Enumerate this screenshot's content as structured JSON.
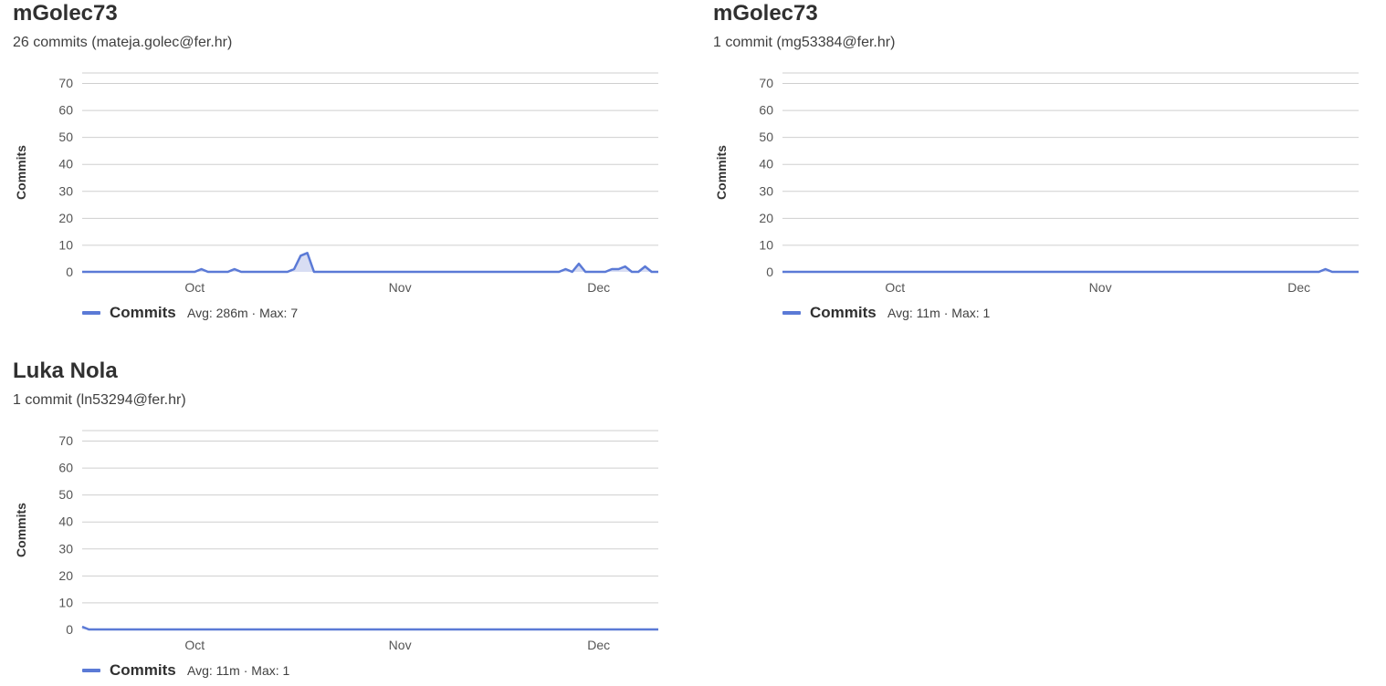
{
  "theme": {
    "line_color": "#5b7ad6",
    "fill_color": "#c7cfee",
    "grid_color": "#cfcfcf"
  },
  "panels": [
    {
      "name": "mGolec73",
      "subtitle": "26 commits (mateja.golec@fer.hr)",
      "legend_label": "Commits",
      "legend_stats": "Avg: 286m · Max: 7"
    },
    {
      "name": "mGolec73",
      "subtitle": "1 commit (mg53384@fer.hr)",
      "legend_label": "Commits",
      "legend_stats": "Avg: 11m · Max: 1"
    },
    {
      "name": "Luka Nola",
      "subtitle": "1 commit (ln53294@fer.hr)",
      "legend_label": "Commits",
      "legend_stats": "Avg: 11m · Max: 1"
    }
  ],
  "chart_data": [
    {
      "type": "area",
      "ylabel": "Commits",
      "ylim": [
        0,
        70
      ],
      "yticks": [
        0,
        10,
        20,
        30,
        40,
        50,
        60,
        70
      ],
      "xlim": [
        "2023-09-14",
        "2023-12-10"
      ],
      "xticks": [
        {
          "date": "2023-10-01",
          "label": "Oct"
        },
        {
          "date": "2023-11-01",
          "label": "Nov"
        },
        {
          "date": "2023-12-01",
          "label": "Dec"
        }
      ],
      "grid": true,
      "legend": "bottom-left",
      "series": [
        {
          "name": "Commits",
          "points": [
            [
              "2023-09-14",
              0
            ],
            [
              "2023-10-01",
              0
            ],
            [
              "2023-10-02",
              1
            ],
            [
              "2023-10-03",
              0
            ],
            [
              "2023-10-06",
              0
            ],
            [
              "2023-10-07",
              1
            ],
            [
              "2023-10-08",
              0
            ],
            [
              "2023-10-15",
              0
            ],
            [
              "2023-10-16",
              1
            ],
            [
              "2023-10-17",
              6
            ],
            [
              "2023-10-18",
              7
            ],
            [
              "2023-10-19",
              0
            ],
            [
              "2023-11-25",
              0
            ],
            [
              "2023-11-26",
              1
            ],
            [
              "2023-11-27",
              0
            ],
            [
              "2023-11-28",
              3
            ],
            [
              "2023-11-29",
              0
            ],
            [
              "2023-12-02",
              0
            ],
            [
              "2023-12-03",
              1
            ],
            [
              "2023-12-04",
              1
            ],
            [
              "2023-12-05",
              2
            ],
            [
              "2023-12-06",
              0
            ],
            [
              "2023-12-07",
              0
            ],
            [
              "2023-12-08",
              2
            ],
            [
              "2023-12-09",
              0
            ],
            [
              "2023-12-10",
              0
            ]
          ]
        }
      ]
    },
    {
      "type": "area",
      "ylabel": "Commits",
      "ylim": [
        0,
        70
      ],
      "yticks": [
        0,
        10,
        20,
        30,
        40,
        50,
        60,
        70
      ],
      "xlim": [
        "2023-09-14",
        "2023-12-10"
      ],
      "xticks": [
        {
          "date": "2023-10-01",
          "label": "Oct"
        },
        {
          "date": "2023-11-01",
          "label": "Nov"
        },
        {
          "date": "2023-12-01",
          "label": "Dec"
        }
      ],
      "grid": true,
      "legend": "bottom-left",
      "series": [
        {
          "name": "Commits",
          "points": [
            [
              "2023-09-14",
              0
            ],
            [
              "2023-12-04",
              0
            ],
            [
              "2023-12-05",
              1
            ],
            [
              "2023-12-06",
              0
            ],
            [
              "2023-12-10",
              0
            ]
          ]
        }
      ]
    },
    {
      "type": "area",
      "ylabel": "Commits",
      "ylim": [
        0,
        70
      ],
      "yticks": [
        0,
        10,
        20,
        30,
        40,
        50,
        60,
        70
      ],
      "xlim": [
        "2023-09-14",
        "2023-12-10"
      ],
      "xticks": [
        {
          "date": "2023-10-01",
          "label": "Oct"
        },
        {
          "date": "2023-11-01",
          "label": "Nov"
        },
        {
          "date": "2023-12-01",
          "label": "Dec"
        }
      ],
      "grid": true,
      "legend": "bottom-left",
      "series": [
        {
          "name": "Commits",
          "points": [
            [
              "2023-09-14",
              1
            ],
            [
              "2023-09-15",
              0
            ],
            [
              "2023-12-10",
              0
            ]
          ]
        }
      ]
    }
  ]
}
